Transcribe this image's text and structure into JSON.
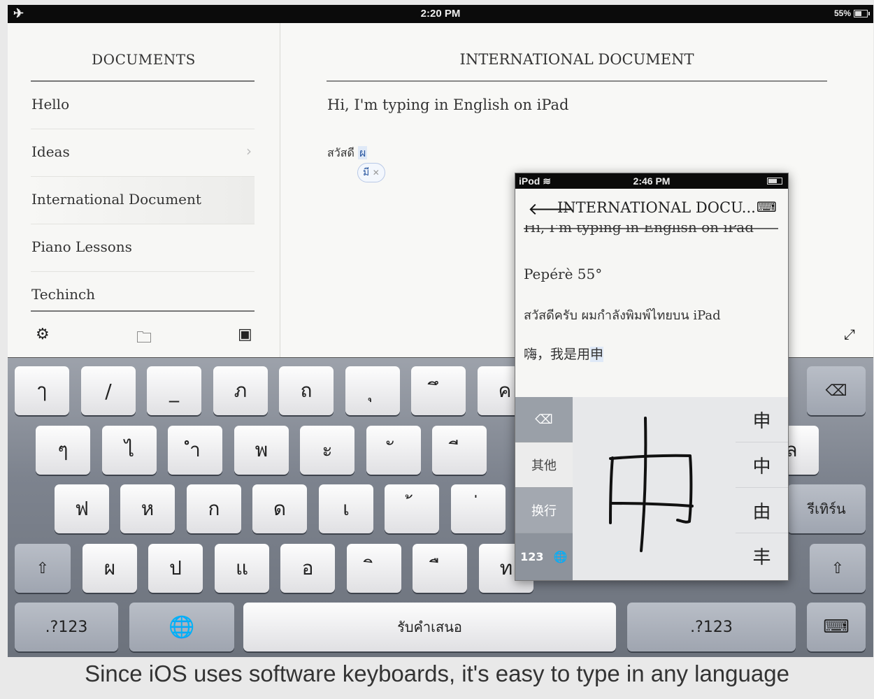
{
  "status_bar": {
    "time": "2:20 PM",
    "battery": "55%"
  },
  "sidebar": {
    "title": "DOCUMENTS",
    "items": [
      {
        "label": "Hello"
      },
      {
        "label": "Ideas"
      },
      {
        "label": "International Document"
      },
      {
        "label": "Piano Lessons"
      },
      {
        "label": "Techinch"
      }
    ]
  },
  "document": {
    "title": "INTERNATIONAL DOCUMENT",
    "line1": "Hi, I'm typing in English on iPad",
    "thai_text": "สวัสดี",
    "thai_highlight": "ผ",
    "suggestion": "มี"
  },
  "keyboard": {
    "row1": [
      "ๅ",
      "/",
      "_",
      "ภ",
      "ถ",
      "ุ",
      "ึ",
      "ค"
    ],
    "row2": [
      "ๆ",
      "ไ",
      "ำ",
      "พ",
      "ะ",
      "ั",
      "ี",
      "ล"
    ],
    "row3": [
      "ฟ",
      "ห",
      "ก",
      "ด",
      "เ",
      "้",
      "่",
      "รีเทิร์น"
    ],
    "row4": [
      "ผ",
      "ป",
      "แ",
      "อ",
      "ิ",
      "ื",
      "ท"
    ],
    "numbers_label": ".?123",
    "space_label": "รับคำเสนอ"
  },
  "iphone": {
    "carrier": "iPod",
    "time": "2:46 PM",
    "title": "INTERNATIONAL DOCU...",
    "lines": [
      "Hi, I'm typing in English on iPad",
      "Pepérè 55°",
      "สวัสดีครับ ผมกำลังพิมพ์ไทยบน iPad",
      "嗨，我是用"
    ],
    "highlight": "申",
    "side_buttons": {
      "other": "其他",
      "enter": "换行",
      "numbers": "123"
    },
    "candidates": [
      "申",
      "中",
      "由",
      "丰"
    ]
  },
  "caption": "Since iOS uses software keyboards, it's easy to type in any language"
}
